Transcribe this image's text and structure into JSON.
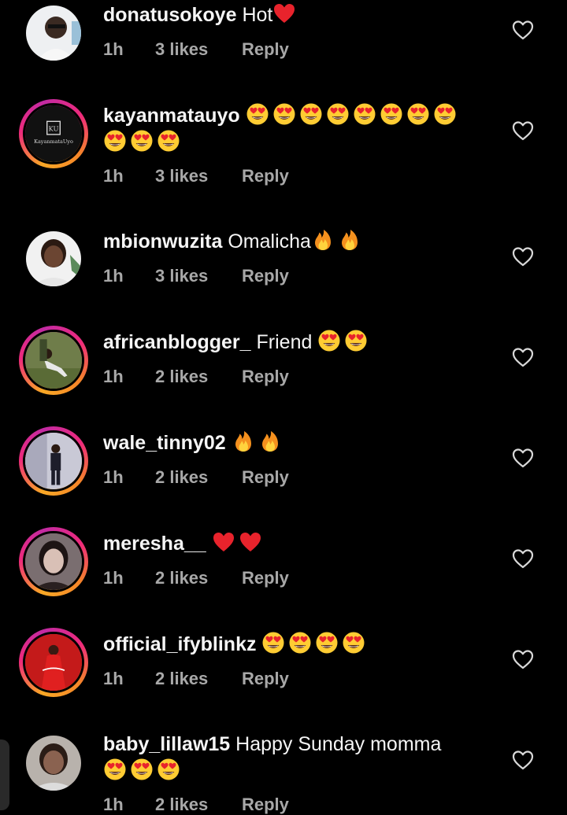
{
  "comments": [
    {
      "username": "donatusokoye",
      "text": "Hot",
      "emojis": [
        "red-heart"
      ],
      "time": "1h",
      "likes": "3 likes",
      "reply": "Reply"
    },
    {
      "username": "kayanmatauyo",
      "text": "",
      "emojis": [
        "heart-eyes",
        "heart-eyes",
        "heart-eyes",
        "heart-eyes",
        "heart-eyes",
        "heart-eyes",
        "heart-eyes",
        "heart-eyes",
        "heart-eyes",
        "heart-eyes",
        "heart-eyes"
      ],
      "time": "1h",
      "likes": "3 likes",
      "reply": "Reply",
      "avatar_text": "KayanmataUyo",
      "avatar_monogram": "KU"
    },
    {
      "username": "mbionwuzita",
      "text": "Omalicha",
      "emojis": [
        "fire",
        "fire"
      ],
      "time": "1h",
      "likes": "3 likes",
      "reply": "Reply"
    },
    {
      "username": "africanblogger_",
      "text": "Friend",
      "emojis": [
        "heart-eyes",
        "heart-eyes"
      ],
      "time": "1h",
      "likes": "2 likes",
      "reply": "Reply"
    },
    {
      "username": "wale_tinny02",
      "text": "",
      "emojis": [
        "fire",
        "fire"
      ],
      "time": "1h",
      "likes": "2 likes",
      "reply": "Reply"
    },
    {
      "username": "meresha__",
      "text": "",
      "emojis": [
        "red-heart",
        "red-heart"
      ],
      "time": "1h",
      "likes": "2 likes",
      "reply": "Reply"
    },
    {
      "username": "official_ifyblinkz",
      "text": "",
      "emojis": [
        "heart-eyes",
        "heart-eyes",
        "heart-eyes",
        "heart-eyes"
      ],
      "time": "1h",
      "likes": "2 likes",
      "reply": "Reply"
    },
    {
      "username": "baby_lillaw15",
      "text": "Happy Sunday momma",
      "emojis": [
        "heart-eyes",
        "heart-eyes",
        "heart-eyes"
      ],
      "time": "1h",
      "likes": "2 likes",
      "reply": "Reply"
    }
  ],
  "icons": {
    "like": "heart-outline-icon"
  },
  "colors": {
    "background": "#000000",
    "text": "#f5f5f5",
    "meta": "#a8a8a8",
    "ring_start": "#f9a825",
    "ring_end": "#c32aa3"
  }
}
